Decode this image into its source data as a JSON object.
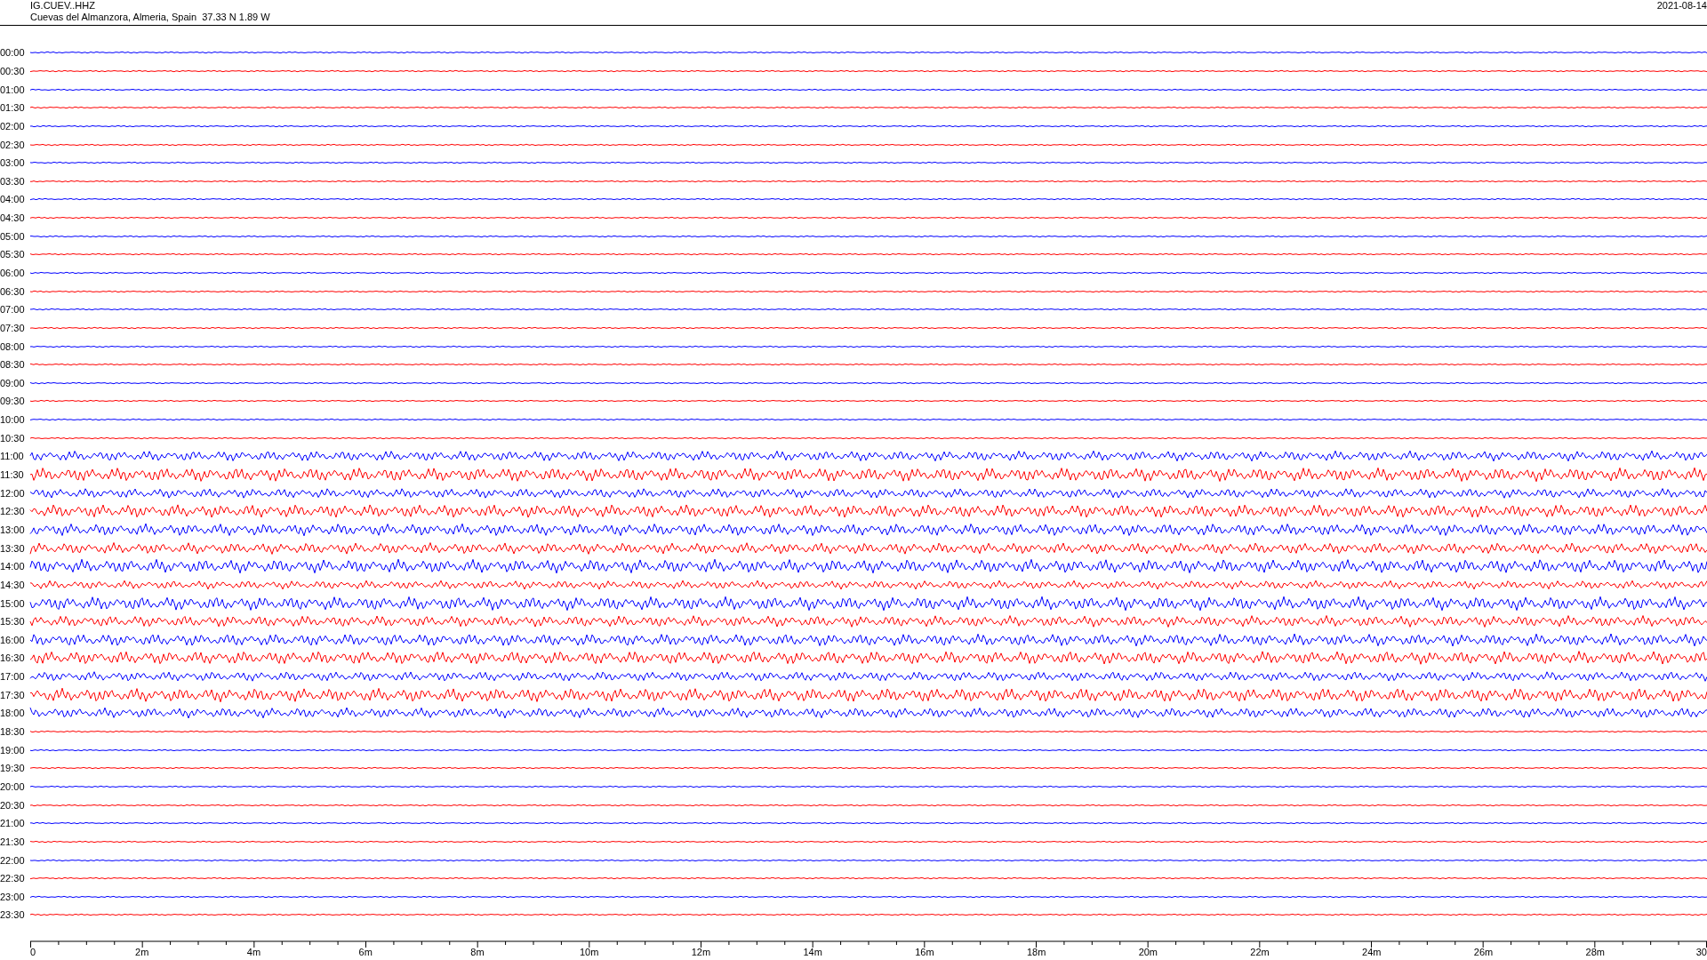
{
  "header": {
    "station": "IG.CUEV..HHZ",
    "location": "Cuevas del Almanzora, Almeria, Spain  37.33 N 1.89 W",
    "date": "2021-08-14"
  },
  "rows": [
    {
      "time": "00:00",
      "color": "#0000ff"
    },
    {
      "time": "00:30",
      "color": "#ff0000"
    },
    {
      "time": "01:00",
      "color": "#0000ff"
    },
    {
      "time": "01:30",
      "color": "#ff0000"
    },
    {
      "time": "02:00",
      "color": "#0000ff"
    },
    {
      "time": "02:30",
      "color": "#ff0000"
    },
    {
      "time": "03:00",
      "color": "#0000ff"
    },
    {
      "time": "03:30",
      "color": "#ff0000"
    },
    {
      "time": "04:00",
      "color": "#0000ff"
    },
    {
      "time": "04:30",
      "color": "#ff0000"
    },
    {
      "time": "05:00",
      "color": "#0000ff"
    },
    {
      "time": "05:30",
      "color": "#ff0000"
    },
    {
      "time": "06:00",
      "color": "#0000ff"
    },
    {
      "time": "06:30",
      "color": "#ff0000"
    },
    {
      "time": "07:00",
      "color": "#0000ff"
    },
    {
      "time": "07:30",
      "color": "#ff0000"
    },
    {
      "time": "08:00",
      "color": "#0000ff"
    },
    {
      "time": "08:30",
      "color": "#ff0000"
    },
    {
      "time": "09:00",
      "color": "#0000ff"
    },
    {
      "time": "09:30",
      "color": "#ff0000"
    },
    {
      "time": "10:00",
      "color": "#0000ff"
    },
    {
      "time": "10:30",
      "color": "#ff0000"
    },
    {
      "time": "11:00",
      "color": "#0000ff"
    },
    {
      "time": "11:30",
      "color": "#ff0000"
    },
    {
      "time": "12:00",
      "color": "#0000ff"
    },
    {
      "time": "12:30",
      "color": "#ff0000"
    },
    {
      "time": "13:00",
      "color": "#0000ff"
    },
    {
      "time": "13:30",
      "color": "#ff0000"
    },
    {
      "time": "14:00",
      "color": "#0000ff"
    },
    {
      "time": "14:30",
      "color": "#ff0000"
    },
    {
      "time": "15:00",
      "color": "#0000ff"
    },
    {
      "time": "15:30",
      "color": "#ff0000"
    },
    {
      "time": "16:00",
      "color": "#0000ff"
    },
    {
      "time": "16:30",
      "color": "#ff0000"
    },
    {
      "time": "17:00",
      "color": "#0000ff"
    },
    {
      "time": "17:30",
      "color": "#ff0000"
    },
    {
      "time": "18:00",
      "color": "#0000ff"
    },
    {
      "time": "18:30",
      "color": "#ff0000"
    },
    {
      "time": "19:00",
      "color": "#0000ff"
    },
    {
      "time": "19:30",
      "color": "#ff0000"
    },
    {
      "time": "20:00",
      "color": "#0000ff"
    },
    {
      "time": "20:30",
      "color": "#ff0000"
    },
    {
      "time": "21:00",
      "color": "#0000ff"
    },
    {
      "time": "21:30",
      "color": "#ff0000"
    },
    {
      "time": "22:00",
      "color": "#0000ff"
    },
    {
      "time": "22:30",
      "color": "#ff0000"
    },
    {
      "time": "23:00",
      "color": "#0000ff"
    },
    {
      "time": "23:30",
      "color": "#ff0000"
    }
  ],
  "axis": {
    "labels": [
      "0",
      "2m",
      "4m",
      "6m",
      "8m",
      "10m",
      "12m",
      "14m",
      "16m",
      "18m",
      "20m",
      "22m",
      "24m",
      "26m",
      "28m",
      "30"
    ]
  }
}
